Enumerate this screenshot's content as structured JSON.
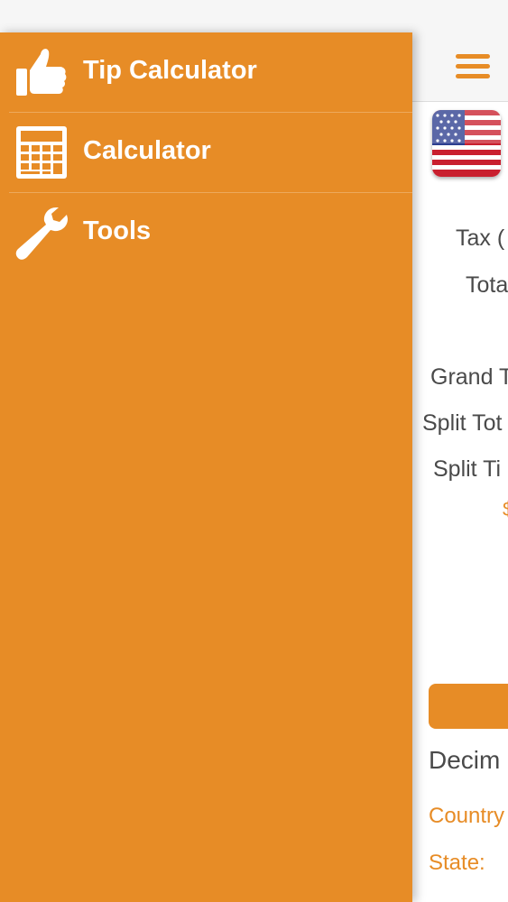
{
  "drawer": {
    "items": [
      {
        "label": "Tip Calculator",
        "icon": "thumbs-up-icon"
      },
      {
        "label": "Calculator",
        "icon": "calculator-icon"
      },
      {
        "label": "Tools",
        "icon": "wrench-icon"
      }
    ]
  },
  "main": {
    "labels": {
      "tax": "Tax (",
      "total": "Tota",
      "grand_total": "Grand T",
      "split_total": "Split Tot",
      "split_tip": "Split Ti",
      "accent_symbol": "$",
      "decimal": "Decim",
      "country": "Country",
      "state": "State:"
    },
    "flag": "us-flag-icon"
  },
  "colors": {
    "accent": "#e78c26",
    "drawer_text": "#ffffff",
    "label_text": "#4a4a4a"
  }
}
